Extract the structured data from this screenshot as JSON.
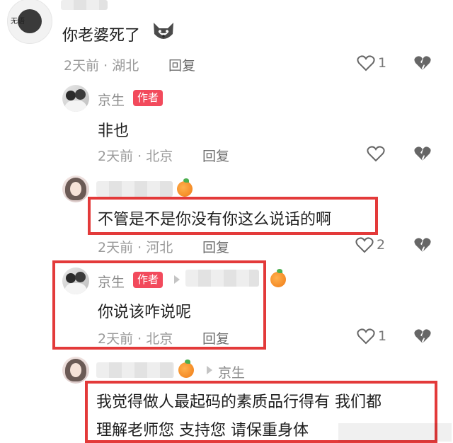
{
  "top_comment": {
    "avatar_text": "无语",
    "text": "你老婆死了",
    "emoji_icon": "husky-dog-emoji",
    "meta": "2天前 · 湖北",
    "reply": "回复",
    "likes": "1"
  },
  "reply1": {
    "author": "京生",
    "badge": "作者",
    "text": "非也",
    "meta": "2天前 · 北京",
    "reply": "回复"
  },
  "reply2": {
    "text": "不管是不是你没有你这么说话的啊",
    "meta": "2天前 · 河北",
    "reply": "回复",
    "likes": "2"
  },
  "reply3": {
    "author": "京生",
    "badge": "作者",
    "text": "你说该咋说呢",
    "meta": "2天前 · 北京",
    "reply": "回复",
    "likes": "1"
  },
  "reply4": {
    "reply_to": "京生",
    "text_line1": "我觉得做人最起码的素质品行得有 我们都",
    "text_line2": "理解老师您 支持您 请保重身体"
  },
  "colors": {
    "highlight_border": "#e33a3a",
    "author_badge": "#f24a5c",
    "meta_text": "#9a9a9a"
  }
}
